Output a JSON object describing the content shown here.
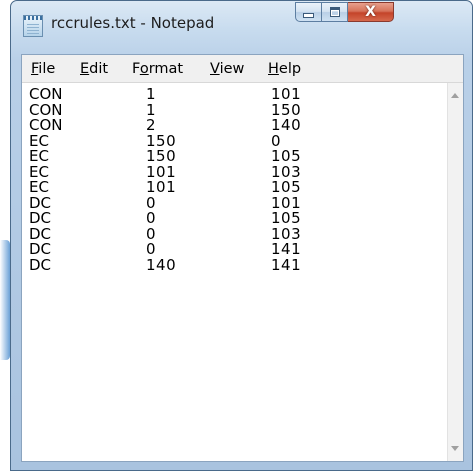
{
  "window": {
    "title": "rccrules.txt - Notepad",
    "icon": "notepad-icon",
    "accent_color": "#b9d0e8",
    "close_color": "#c4442a"
  },
  "caption": {
    "minimize_icon": "minimize-icon",
    "maximize_icon": "maximize-icon",
    "close_glyph": "X"
  },
  "menu": {
    "items": [
      {
        "first": "F",
        "rest": "ile"
      },
      {
        "first": "E",
        "rest": "dit"
      },
      {
        "pre": "F",
        "first": "o",
        "rest": "rmat"
      },
      {
        "first": "V",
        "rest": "iew"
      },
      {
        "first": "H",
        "rest": "elp"
      }
    ]
  },
  "document": {
    "lines": [
      [
        "CON",
        "1",
        "101"
      ],
      [
        "CON",
        "1",
        "150"
      ],
      [
        "CON",
        "2",
        "140"
      ],
      [
        "EC",
        "150",
        "0"
      ],
      [
        "EC",
        "150",
        "105"
      ],
      [
        "EC",
        "101",
        "103"
      ],
      [
        "EC",
        "101",
        "105"
      ],
      [
        "DC",
        "0",
        "101"
      ],
      [
        "DC",
        "0",
        "105"
      ],
      [
        "DC",
        "0",
        "103"
      ],
      [
        "DC",
        "0",
        "141"
      ],
      [
        "DC",
        "140",
        "141"
      ]
    ]
  },
  "scrollbar": {
    "up_icon": "scroll-up-arrow-icon",
    "down_icon": "scroll-down-arrow-icon"
  }
}
